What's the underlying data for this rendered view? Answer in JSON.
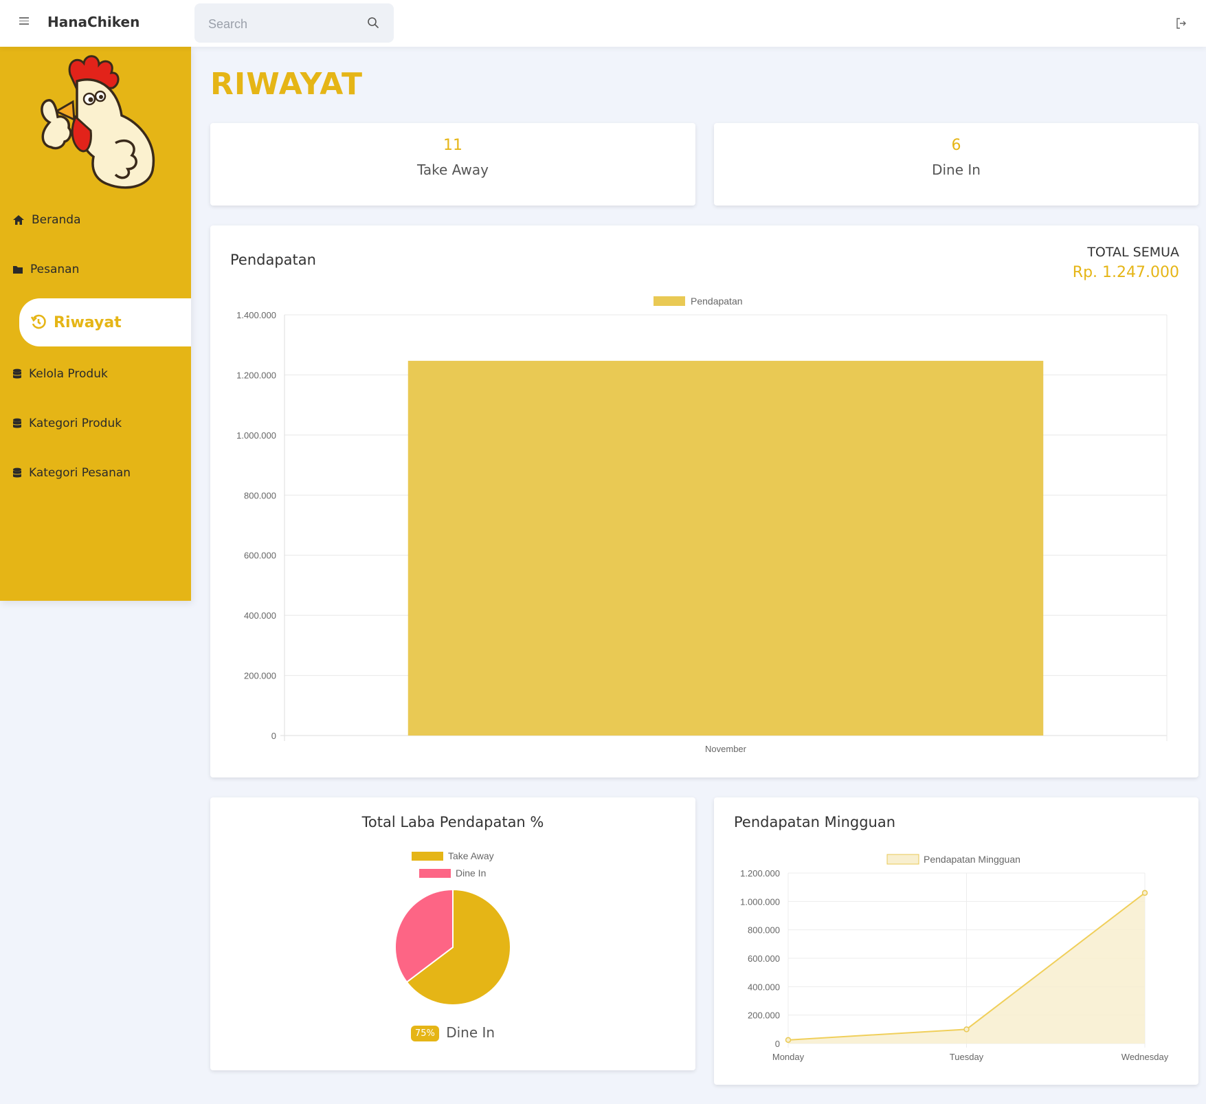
{
  "app": {
    "brand": "HanaChiken"
  },
  "search": {
    "placeholder": "Search"
  },
  "sidebar": {
    "items": [
      {
        "label": "Beranda",
        "icon": "home-icon"
      },
      {
        "label": "Pesanan",
        "icon": "folder-icon"
      },
      {
        "label": "Riwayat",
        "icon": "history-icon",
        "active": true
      },
      {
        "label": "Kelola Produk",
        "icon": "database-icon"
      },
      {
        "label": "Kategori Produk",
        "icon": "database-icon"
      },
      {
        "label": "Kategori Pesanan",
        "icon": "database-icon"
      }
    ]
  },
  "page": {
    "title": "RIWAYAT"
  },
  "stats": [
    {
      "value": "11",
      "label": "Take Away"
    },
    {
      "value": "6",
      "label": "Dine In"
    }
  ],
  "revenue": {
    "title": "Pendapatan",
    "total_label": "TOTAL SEMUA",
    "total_value": "Rp. 1.247.000"
  },
  "pie_card": {
    "title": "Total Laba Pendapatan %",
    "badge": "75%",
    "caption": "Dine In"
  },
  "weekly_card": {
    "title": "Pendapatan Mingguan"
  },
  "colors": {
    "accent": "#e5b516",
    "bar": "#e9c954",
    "pink": "#fd6585",
    "area": "#f8efcf"
  },
  "chart_data": [
    {
      "type": "bar",
      "categories": [
        "November"
      ],
      "series": [
        {
          "name": "Pendapatan",
          "values": [
            1247000
          ]
        }
      ],
      "ylim": [
        0,
        1400000
      ],
      "yticks": [
        "0",
        "200.000",
        "400.000",
        "600.000",
        "800.000",
        "1.000.000",
        "1.200.000",
        "1.400.000"
      ],
      "legend": "top"
    },
    {
      "type": "pie",
      "labels": [
        "Take Away",
        "Dine In"
      ],
      "values": [
        11,
        6
      ],
      "legend": "top"
    },
    {
      "type": "area",
      "categories": [
        "Monday",
        "Tuesday",
        "Wednesday"
      ],
      "series": [
        {
          "name": "Pendapatan Mingguan",
          "values": [
            25000,
            100000,
            1060000
          ]
        }
      ],
      "ylim": [
        0,
        1200000
      ],
      "yticks": [
        "0",
        "200.000",
        "400.000",
        "600.000",
        "800.000",
        "1.000.000",
        "1.200.000"
      ],
      "legend": "top"
    }
  ]
}
